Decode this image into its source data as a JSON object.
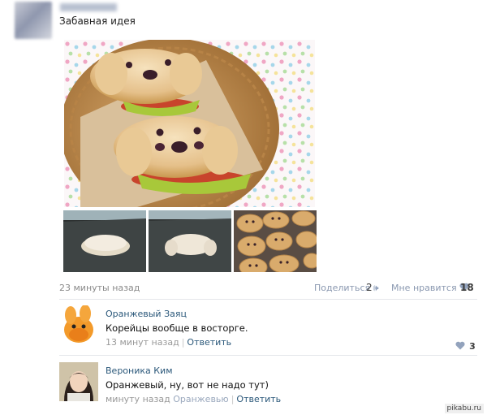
{
  "post": {
    "text": "Забавная идея",
    "time": "23 минуты назад",
    "share_label": "Поделиться",
    "share_count": "2",
    "like_label": "Мне нравится",
    "like_count": "18"
  },
  "comments": [
    {
      "author": "Оранжевый Заяц",
      "text": "Корейцы вообще в восторге.",
      "time": "13 минут назад",
      "reply_label": "Ответить",
      "likes": "3"
    },
    {
      "author": "Вероника Ким",
      "text": "Оранжевый, ну, вот не надо тут)",
      "time": "минуту назад",
      "reply_to": "Оранжевью",
      "reply_label": "Ответить"
    }
  ],
  "watermark": "pikabu.ru",
  "colors": {
    "link": "#2b587a",
    "meta": "#8a98b0",
    "heart": "#93a3bd"
  }
}
